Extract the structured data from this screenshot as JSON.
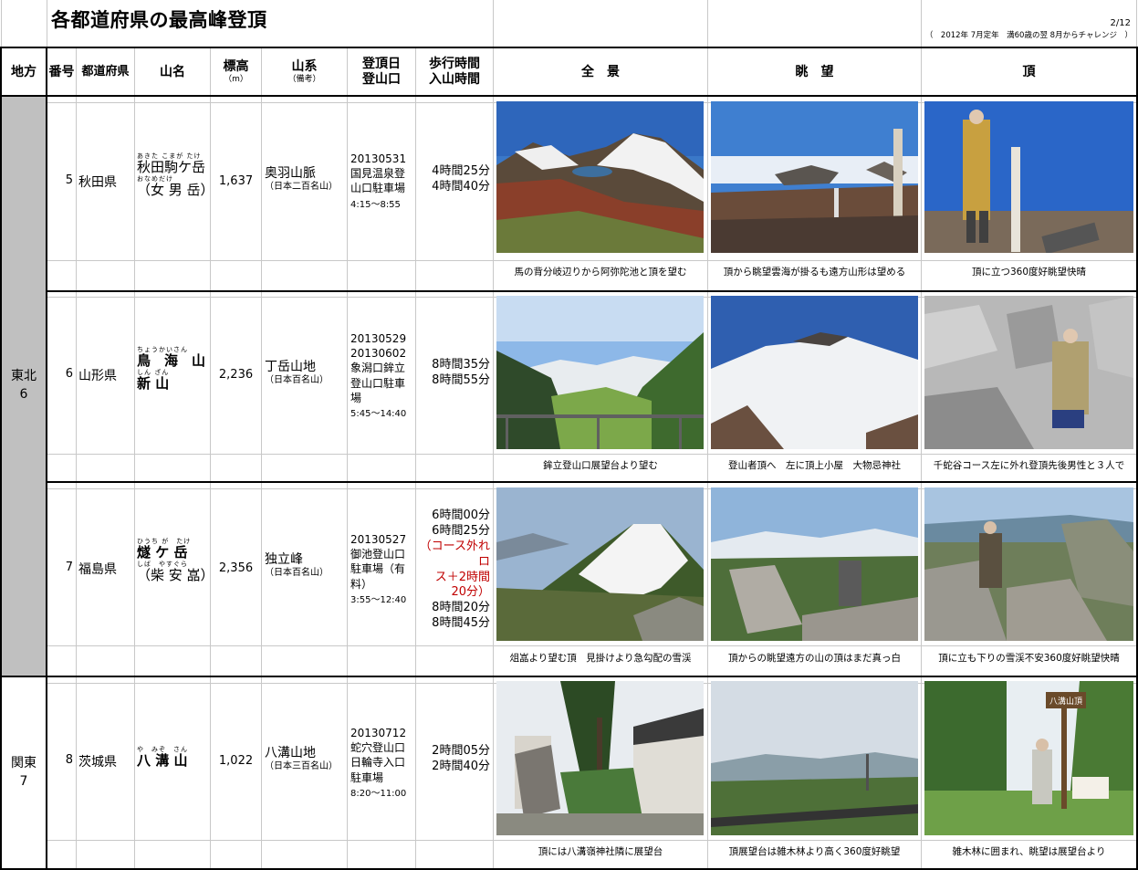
{
  "title": "各都道府県の最高峰登頂",
  "page": "2/12",
  "note": "（　2012年 7月定年　満60歳の翌 8月からチャレンジ　）",
  "headers": {
    "region": "地方",
    "number": "番号",
    "prefecture": "都道府県",
    "mountain": "山名",
    "altitude": "標高",
    "altitude_unit": "（m）",
    "range": "山系",
    "range_sub": "（備考）",
    "climb_date": "登頂日",
    "climb_trailhead": "登山口",
    "walk_time": "歩行時間",
    "total_time": "入山時間",
    "photo_full": "全　景",
    "photo_view": "眺　望",
    "photo_summit": "頂"
  },
  "regions": [
    {
      "name": "東北",
      "count": "6"
    },
    {
      "name": "関東",
      "count": "7"
    }
  ],
  "rows": [
    {
      "number": "5",
      "prefecture": "秋田県",
      "ruby1": "あきた こまが たけ",
      "name1": "秋田駒ケ岳",
      "ruby2": "おなめだけ",
      "name2": "（女 男 岳）",
      "altitude": "1,637",
      "range": "奥羽山脈",
      "range_note": "（日本二百名山）",
      "date": "20130531",
      "trailhead": "国見温泉登山口駐車場",
      "times": "4:15〜8:55",
      "walk": "4時間25分",
      "walk_total": "4時間40分",
      "captions": [
        "馬の背分岐辺りから阿弥陀池と頂を望む",
        "頂から眺望雲海が掛るも遠方山形は望める",
        "頂に立つ360度好眺望快晴"
      ]
    },
    {
      "number": "6",
      "prefecture": "山形県",
      "ruby1": "ちょうかいさん",
      "name1": "鳥　海　山",
      "ruby2": "しん ざん",
      "name2": "新 山",
      "altitude": "2,236",
      "range": "丁岳山地",
      "range_note": "（日本百名山）",
      "date": "20130529",
      "date2": "20130602",
      "trailhead": "象潟口鉾立登山口駐車場",
      "times": "5:45〜14:40",
      "walk": "8時間35分",
      "walk_total": "8時間55分",
      "captions": [
        "鉾立登山口展望台より望む",
        "登山者頂へ　左に頂上小屋　大物忌神社",
        "千蛇谷コース左に外れ登頂先後男性と３人で"
      ]
    },
    {
      "number": "7",
      "prefecture": "福島県",
      "ruby1": "ひうち が　たけ",
      "name1": "燧 ケ 岳",
      "ruby2": "しば　やすぐら",
      "name2": "（柴 安 嵓）",
      "altitude": "2,356",
      "range": "独立峰",
      "range_note": "（日本百名山）",
      "date": "20130527",
      "trailhead": "御池登山口駐車場（有料）",
      "times": "3:55〜12:40",
      "walk": "6時間00分",
      "walk_alt": "6時間25分",
      "walk_note1": "（コース外れロ",
      "walk_note2": "ス＋2時間",
      "walk_note3": "20分）",
      "walk_total": "8時間20分",
      "walk_total2": "8時間45分",
      "captions": [
        "俎嵓より望む頂　見掛けより急勾配の雪渓",
        "頂からの眺望遠方の山の頂はまだ真っ白",
        "頂に立も下りの雪渓不安360度好眺望快晴"
      ]
    },
    {
      "number": "8",
      "prefecture": "茨城県",
      "ruby1": "や　みぞ　さん",
      "name1": "八 溝 山",
      "altitude": "1,022",
      "range": "八溝山地",
      "range_note": "（日本三百名山）",
      "date": "20130712",
      "trailhead": "蛇穴登山口日輪寺入口駐車場",
      "times": "8:20〜11:00",
      "walk": "2時間05分",
      "walk_total": "2時間40分",
      "captions": [
        "頂には八溝嶺神社隣に展望台",
        "頂展望台は雑木林より高く360度好眺望",
        "雑木林に囲まれ、眺望は展望台より"
      ],
      "sign_text": "八溝山頂"
    }
  ]
}
